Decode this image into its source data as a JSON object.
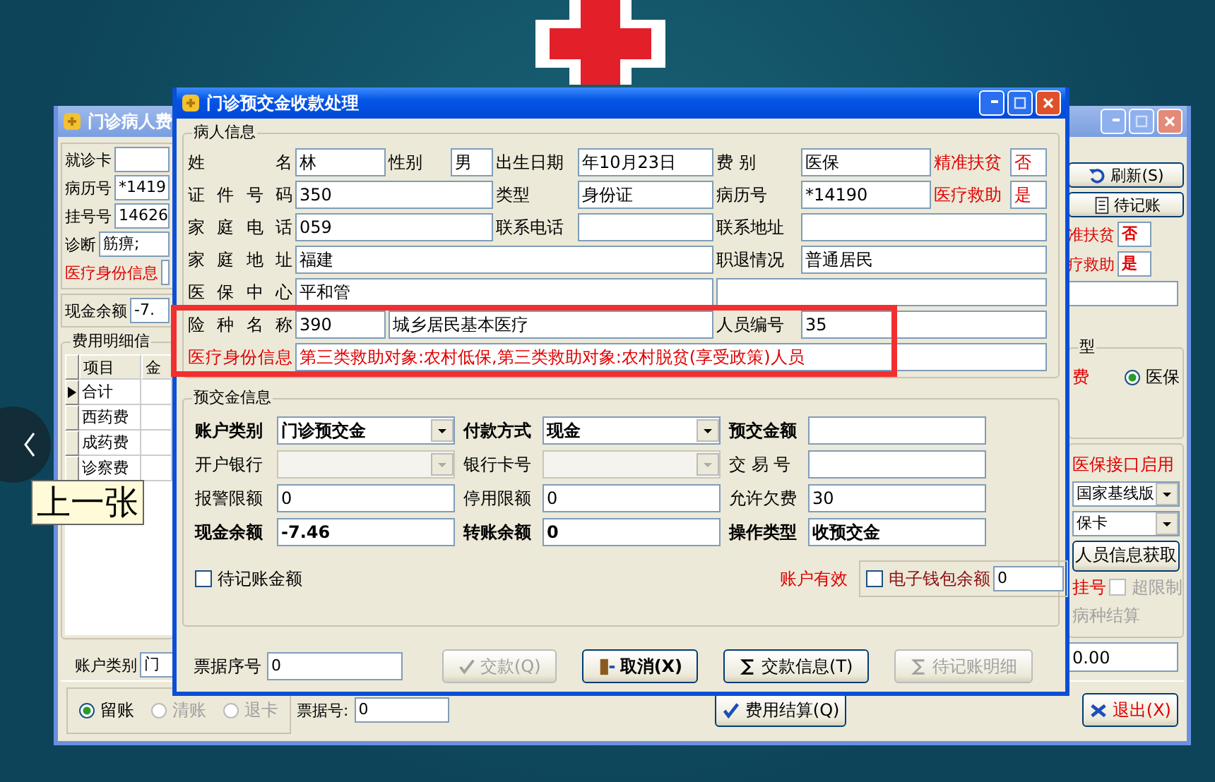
{
  "nav": {
    "previous_tooltip": "上一张"
  },
  "back_window": {
    "title": "门诊病人费",
    "fields": [
      {
        "label": "就诊卡"
      },
      {
        "label": "病历号",
        "value": "*1419"
      },
      {
        "label": "挂号号",
        "value": "14626"
      },
      {
        "label": "诊断",
        "value": "筋痹;"
      }
    ],
    "identity_label": "医疗身份信息",
    "cash": {
      "label": "现金余额",
      "value": "-7."
    },
    "detail_group": "费用明细信",
    "table": {
      "columns": [
        "项目",
        "金"
      ],
      "rows": [
        {
          "item": "合计",
          "selected": true
        },
        {
          "item": "西药费",
          "selected": false
        },
        {
          "item": "成药费",
          "selected": false
        },
        {
          "item": "诊察费",
          "selected": false
        }
      ]
    },
    "account": {
      "label": "账户类别",
      "value": "门"
    },
    "side": {
      "buttons": [
        {
          "label": "刷新(S)",
          "kind": "refresh"
        },
        {
          "label": "待记账",
          "kind": "document"
        }
      ],
      "flags": [
        {
          "label": "准扶贫",
          "value": "否"
        },
        {
          "label": "疗救助",
          "value": "是"
        }
      ],
      "group_title": "型",
      "group_red": "费",
      "radio": {
        "label": "医保",
        "selected": true
      },
      "interface_label": "医保接口启用",
      "selects": [
        "国家基线版",
        "保卡"
      ],
      "fetch_button": "人员信息获取",
      "register_label": "挂号",
      "limit_checkbox": {
        "label": "超限制",
        "checked": false,
        "disabled": true
      },
      "settle_label": "病种结算",
      "amount": "0.00"
    },
    "bottom": {
      "radios": [
        {
          "label": "留账",
          "selected": true,
          "disabled": false
        },
        {
          "label": "清账",
          "selected": false,
          "disabled": true
        },
        {
          "label": "退卡",
          "selected": false,
          "disabled": true
        }
      ],
      "receipt_label": "票据号:",
      "receipt_value": "0",
      "settle_button": "费用结算(Q)",
      "exit_button": "退出(X)"
    }
  },
  "dialog": {
    "title": "门诊预交金收款处理",
    "patient_group": "病人信息",
    "patient_rows": [
      [
        {
          "kind": "label",
          "text": "姓 名",
          "red": false
        },
        {
          "kind": "field",
          "value": "林",
          "red": false
        },
        {
          "kind": "label",
          "text": "性别",
          "red": false
        },
        {
          "kind": "field",
          "value": "男",
          "red": false
        },
        {
          "kind": "label",
          "text": "出生日期",
          "red": false
        },
        {
          "kind": "field",
          "value": "年10月23日",
          "red": false
        },
        {
          "kind": "label",
          "text": "费 别",
          "red": false
        },
        {
          "kind": "field",
          "value": "医保",
          "red": false
        },
        {
          "kind": "label",
          "text": "精准扶贫",
          "red": true
        },
        {
          "kind": "field",
          "value": "否",
          "red": true
        }
      ],
      [
        {
          "kind": "label",
          "text": "证件号码",
          "red": false
        },
        {
          "kind": "field",
          "value": "350",
          "red": false
        },
        {
          "kind": "label",
          "text": "类型",
          "red": false
        },
        {
          "kind": "field",
          "value": "身份证",
          "red": false
        },
        {
          "kind": "label",
          "text": "病历号",
          "red": false
        },
        {
          "kind": "field",
          "value": "*14190",
          "red": false
        },
        {
          "kind": "label",
          "text": "医疗救助",
          "red": true
        },
        {
          "kind": "field",
          "value": "是",
          "red": true
        }
      ],
      [
        {
          "kind": "label",
          "text": "家庭电话",
          "red": false
        },
        {
          "kind": "field",
          "value": "059",
          "red": false
        },
        {
          "kind": "label",
          "text": "联系电话",
          "red": false
        },
        {
          "kind": "field"
        },
        {
          "kind": "label",
          "text": "联系地址",
          "red": false
        },
        {
          "kind": "field"
        }
      ],
      [
        {
          "kind": "label",
          "text": "家庭地址",
          "red": false
        },
        {
          "kind": "field",
          "value": "福建",
          "red": false
        },
        {
          "kind": "label",
          "text": "职退情况",
          "red": false
        },
        {
          "kind": "field",
          "value": "普通居民",
          "red": false
        }
      ],
      [
        {
          "kind": "label",
          "text": "医保中心",
          "red": false
        },
        {
          "kind": "field",
          "value": "平和管",
          "red": false
        },
        {
          "kind": "field"
        }
      ],
      [
        {
          "kind": "label",
          "text": "险种名称",
          "red": false
        },
        {
          "kind": "field",
          "value": "390",
          "red": false
        },
        {
          "kind": "field",
          "value": "城乡居民基本医疗",
          "red": false
        },
        {
          "kind": "label",
          "text": "人员编号",
          "red": false
        },
        {
          "kind": "field",
          "value": "35",
          "red": false
        }
      ],
      [
        {
          "kind": "label",
          "text": "医疗身份信息",
          "red": true
        },
        {
          "kind": "field",
          "value": "第三类救助对象:农村低保,第三类救助对象:农村脱贫(享受政策)人员",
          "red": true
        }
      ]
    ],
    "pay_group": "预交金信息",
    "pay_fields": [
      {
        "label": "账户类别",
        "value": "门诊预交金",
        "kind": "select",
        "bold": true,
        "disabled": false
      },
      {
        "label": "付款方式",
        "value": "现金",
        "kind": "select",
        "bold": true,
        "disabled": false
      },
      {
        "label": "预交金额",
        "kind": "text",
        "bold": true,
        "disabled": false
      },
      {
        "label": "开户银行",
        "kind": "select",
        "bold": false,
        "disabled": true
      },
      {
        "label": "银行卡号",
        "kind": "select",
        "bold": false,
        "disabled": true
      },
      {
        "label": "交 易 号",
        "kind": "text",
        "bold": false,
        "disabled": false
      },
      {
        "label": "报警限额",
        "value": "0",
        "kind": "text",
        "bold": false,
        "disabled": false
      },
      {
        "label": "停用限额",
        "value": "0",
        "kind": "text",
        "bold": false,
        "disabled": false
      },
      {
        "label": "允许欠费",
        "value": "30",
        "kind": "text",
        "bold": false,
        "disabled": false
      },
      {
        "label": "现金余额",
        "value": "-7.46",
        "kind": "text",
        "bold": true,
        "disabled": false
      },
      {
        "label": "转账余额",
        "value": "0",
        "kind": "text",
        "bold": true,
        "disabled": false
      },
      {
        "label": "操作类型",
        "value": "收预交金",
        "kind": "text",
        "bold": true,
        "disabled": false
      }
    ],
    "pending_checkbox": {
      "label": "待记账金额",
      "checked": false
    },
    "account_status": "账户有效",
    "wallet": {
      "label": "电子钱包余额",
      "checked": false,
      "value": "0"
    },
    "receipt": {
      "label": "票据序号",
      "value": "0"
    },
    "buttons": [
      {
        "label": "交款(Q)",
        "kind": "check",
        "disabled": true
      },
      {
        "label": "取消(X)",
        "kind": "exit",
        "disabled": false
      },
      {
        "label": "交款信息(T)",
        "kind": "sigma",
        "disabled": false
      },
      {
        "label": "待记账明细",
        "kind": "sigma",
        "disabled": true
      }
    ]
  }
}
